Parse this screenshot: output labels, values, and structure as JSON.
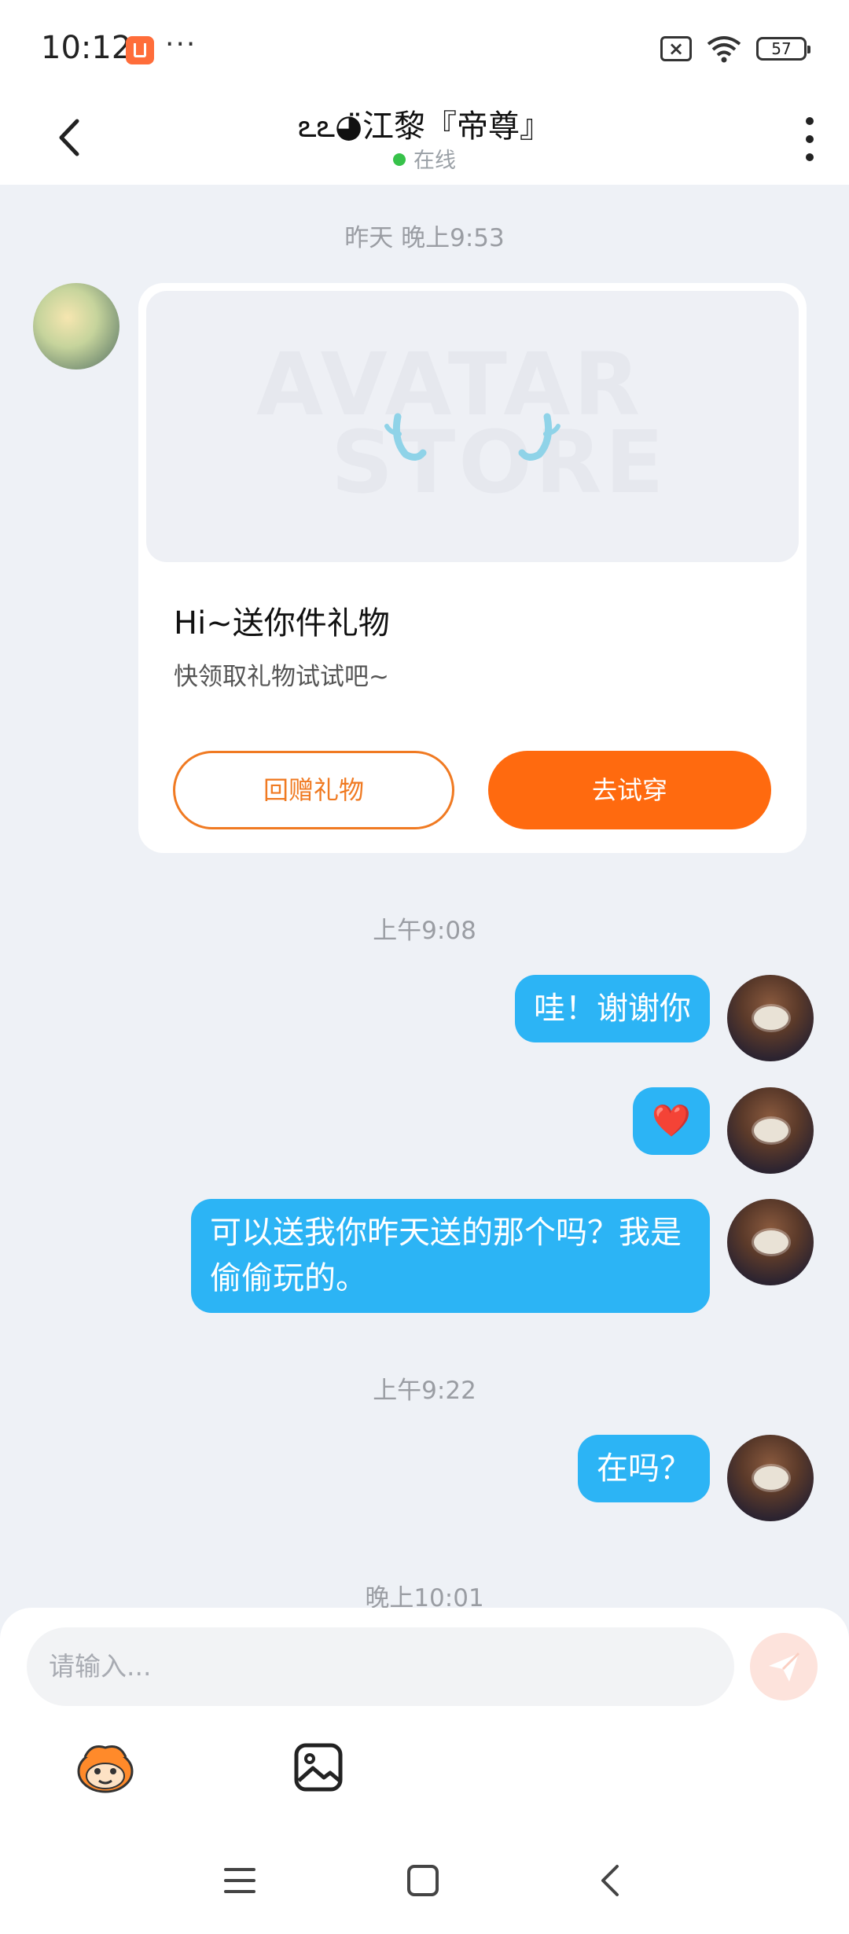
{
  "status_bar": {
    "time": "10:12",
    "dots": "···",
    "sim_icon": "×",
    "battery": "57"
  },
  "header": {
    "title": "ఽఽ◕̈江黎『帝尊』",
    "status": "在线"
  },
  "messages": {
    "ts1": "昨天 晚上9:53",
    "gift": {
      "watermark_line1": "AVATAR",
      "watermark_line2": "STORE",
      "title": "Hi~送你件礼物",
      "subtitle": "快领取礼物试试吧~",
      "return_label": "回赠礼物",
      "try_label": "去试穿"
    },
    "ts2": "上午9:08",
    "m1": "哇！谢谢你",
    "m2": "❤️",
    "m3": "可以送我你昨天送的那个吗？我是偷偷玩的。",
    "ts3": "上午9:22",
    "m4": "在吗？",
    "ts4": "晚上10:01"
  },
  "composer": {
    "placeholder": "请输入..."
  },
  "colors": {
    "accent_orange": "#ff6a0f",
    "bubble_blue": "#2cb4f5",
    "online_green": "#37c24a"
  },
  "icons": [
    "back-arrow-icon",
    "more-vertical-icon",
    "send-icon",
    "emoji-icon",
    "image-icon",
    "menu-icon",
    "home-icon",
    "back-nav-icon"
  ]
}
